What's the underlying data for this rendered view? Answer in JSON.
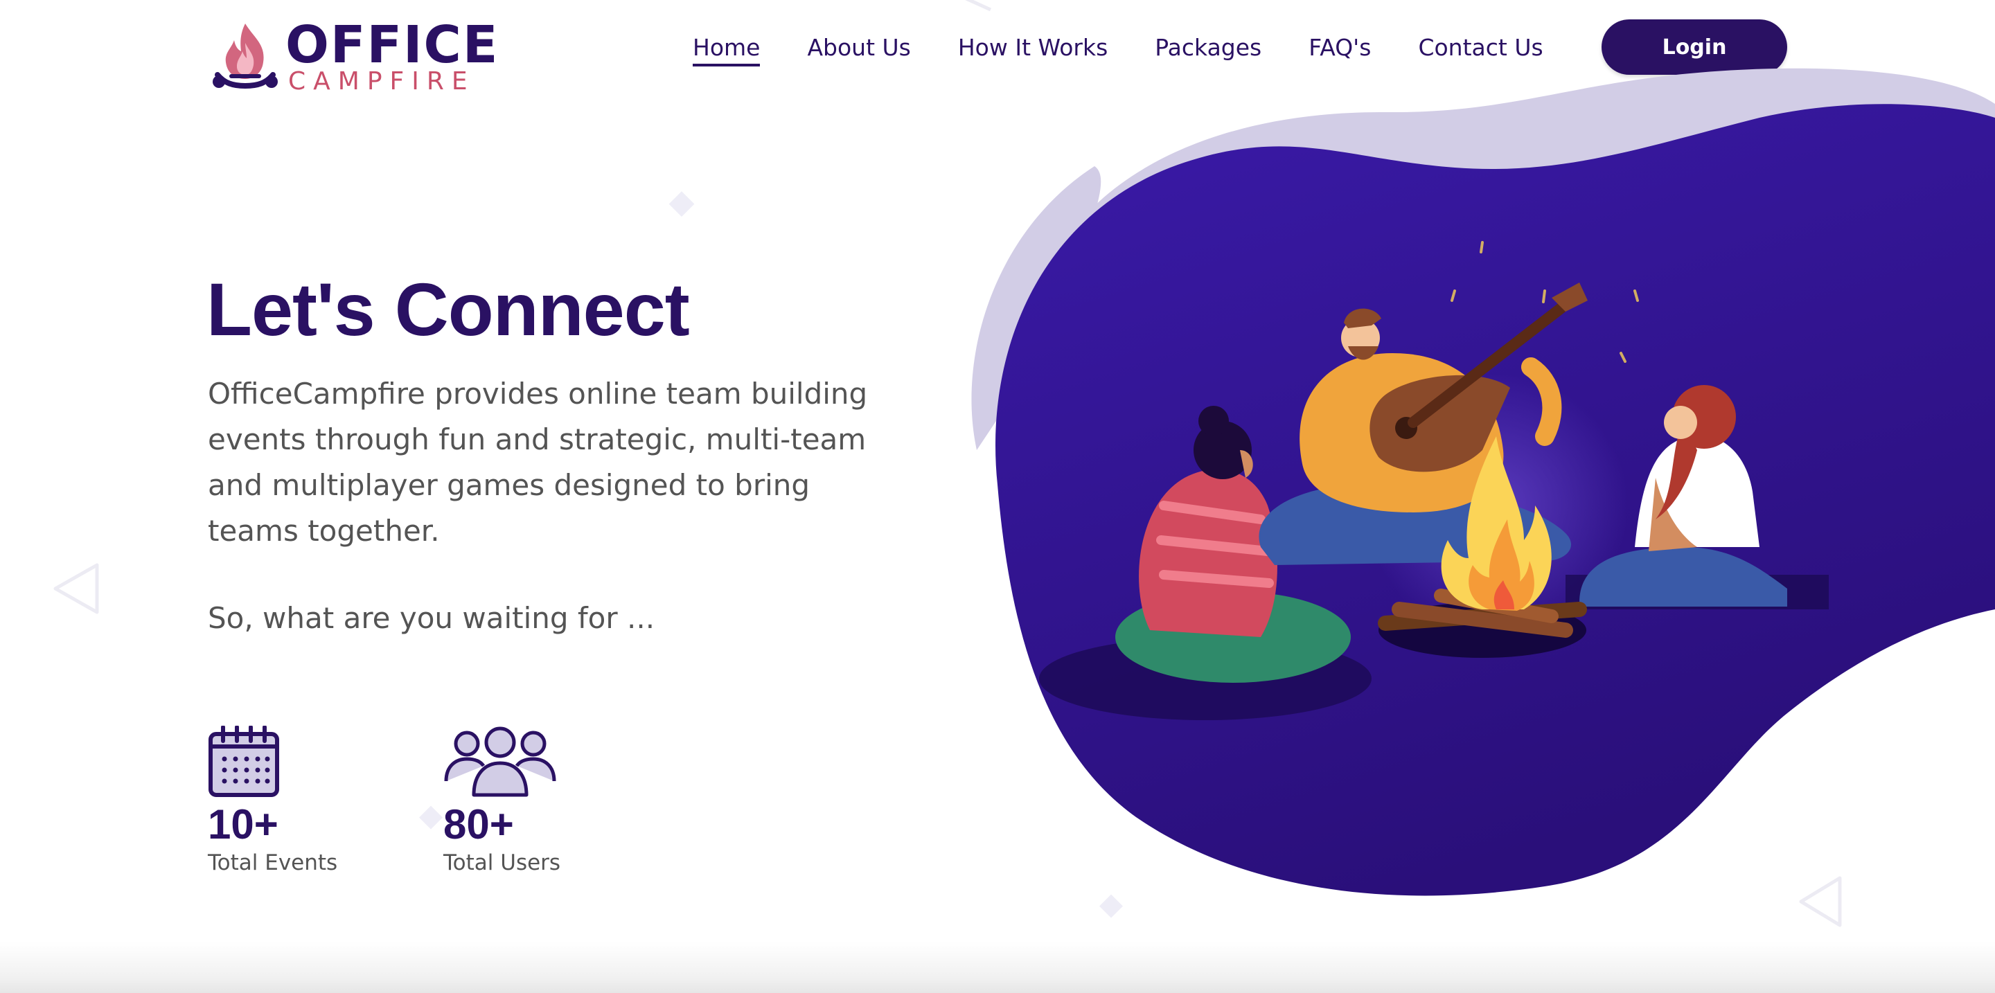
{
  "header": {
    "logo": {
      "line1": "OFFICE",
      "line2": "CAMPFIRE"
    },
    "nav": [
      {
        "label": "Home",
        "active": true
      },
      {
        "label": "About Us",
        "active": false
      },
      {
        "label": "How It Works",
        "active": false
      },
      {
        "label": "Packages",
        "active": false
      },
      {
        "label": "FAQ's",
        "active": false
      },
      {
        "label": "Contact Us",
        "active": false
      }
    ],
    "login_label": "Login"
  },
  "hero": {
    "title": "Let's Connect",
    "description": "OfficeCampfire provides online team building events through fun and strategic, multi-team and multiplayer games designed to bring teams together.",
    "subtext": "So, what are you waiting for ...",
    "stats": [
      {
        "value": "10+",
        "label": "Total Events",
        "icon": "calendar-icon"
      },
      {
        "value": "80+",
        "label": "Total Users",
        "icon": "users-icon"
      }
    ]
  },
  "colors": {
    "brand_primary": "#2a1163",
    "brand_accent": "#c94f6a",
    "blob_purple": "#3a1aa8",
    "blob_lavender": "#d2cde6",
    "body_text": "#545454"
  }
}
